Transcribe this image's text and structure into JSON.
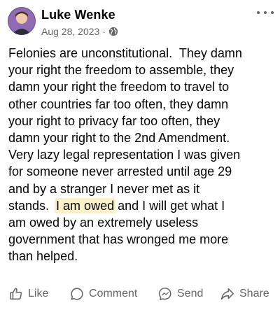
{
  "post": {
    "author": "Luke Wenke",
    "date": "Aug 28, 2023",
    "separator": "·",
    "privacy_icon": "globe-icon",
    "menu_icon": "more-horizontal-icon",
    "body_lines": [
      "Felonies are unconstitutional.  They damn",
      "your right the freedom to assemble, they",
      "damn your right the freedom to travel to",
      "other countries far too often, they damn",
      "your right to privacy far too often, they",
      "damn your right to the 2nd Amendment.",
      "Very lazy legal representation I was given",
      "for someone never arrested until age 29",
      "and by a stranger I never met as it"
    ],
    "line10_before": "stands.  ",
    "line10_highlight": "I am owed",
    "line10_after": " and I will get what I",
    "body_lines_end": [
      "am owed by an extremely useless",
      "government that has wronged me more",
      "than helped."
    ],
    "highlight_color": "#fbf0c8"
  },
  "actions": {
    "like_label": "Like",
    "comment_label": "Comment",
    "send_label": "Send",
    "share_label": "Share",
    "icon_color": "#65676b"
  }
}
